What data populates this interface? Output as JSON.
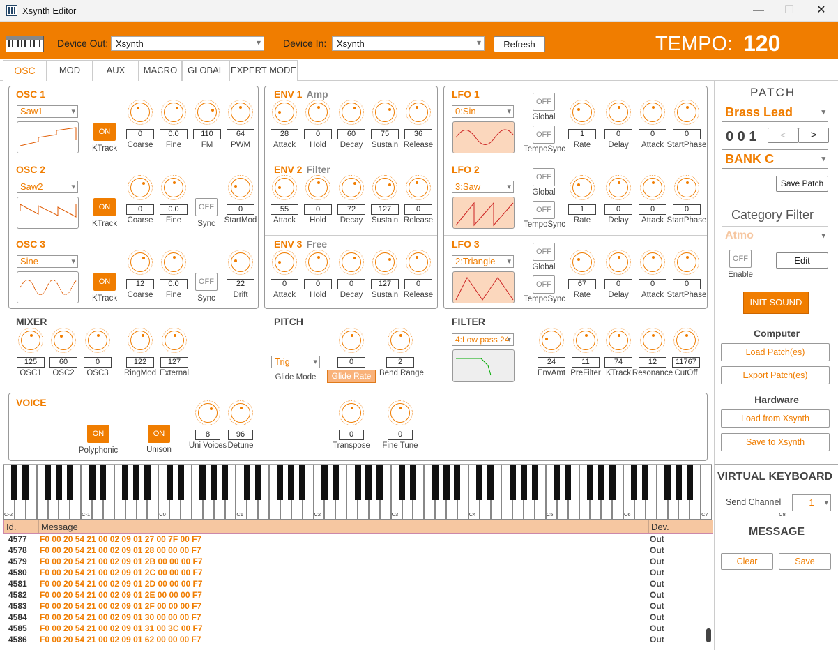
{
  "window": {
    "title": "Xsynth Editor",
    "minimize": "—",
    "maximize": "☐",
    "close": "✕"
  },
  "header": {
    "device_out_label": "Device Out:",
    "device_out_value": "Xsynth",
    "device_in_label": "Device In:",
    "device_in_value": "Xsynth",
    "refresh": "Refresh",
    "tempo_label": "TEMPO:",
    "tempo_value": "120"
  },
  "tabs": [
    "OSC",
    "MOD",
    "AUX",
    "MACRO",
    "GLOBAL",
    "EXPERT MODE"
  ],
  "osc": [
    {
      "title": "OSC 1",
      "wave": "Saw1",
      "ktrack": "ON",
      "ktrack_label": "KTrack",
      "params": [
        {
          "v": "0",
          "l": "Coarse"
        },
        {
          "v": "0.0",
          "l": "Fine"
        },
        {
          "v": "110",
          "l": "FM"
        },
        {
          "v": "64",
          "l": "PWM"
        }
      ]
    },
    {
      "title": "OSC 2",
      "wave": "Saw2",
      "ktrack": "ON",
      "ktrack_label": "KTrack",
      "sync": "OFF",
      "sync_label": "Sync",
      "params": [
        {
          "v": "0",
          "l": "Coarse"
        },
        {
          "v": "0.0",
          "l": "Fine"
        },
        {
          "v": "0",
          "l": "StartMod"
        }
      ]
    },
    {
      "title": "OSC 3",
      "wave": "Sine",
      "ktrack": "ON",
      "ktrack_label": "KTrack",
      "sync": "OFF",
      "sync_label": "Sync",
      "params": [
        {
          "v": "12",
          "l": "Coarse"
        },
        {
          "v": "0.0",
          "l": "Fine"
        },
        {
          "v": "22",
          "l": "Drift"
        }
      ]
    }
  ],
  "env": [
    {
      "title": "ENV 1",
      "sub": "Amp",
      "params": [
        {
          "v": "28",
          "l": "Attack"
        },
        {
          "v": "0",
          "l": "Hold"
        },
        {
          "v": "60",
          "l": "Decay"
        },
        {
          "v": "75",
          "l": "Sustain"
        },
        {
          "v": "36",
          "l": "Release"
        }
      ]
    },
    {
      "title": "ENV 2",
      "sub": "Filter",
      "params": [
        {
          "v": "55",
          "l": "Attack"
        },
        {
          "v": "0",
          "l": "Hold"
        },
        {
          "v": "72",
          "l": "Decay"
        },
        {
          "v": "127",
          "l": "Sustain"
        },
        {
          "v": "0",
          "l": "Release"
        }
      ]
    },
    {
      "title": "ENV 3",
      "sub": "Free",
      "params": [
        {
          "v": "0",
          "l": "Attack"
        },
        {
          "v": "0",
          "l": "Hold"
        },
        {
          "v": "0",
          "l": "Decay"
        },
        {
          "v": "127",
          "l": "Sustain"
        },
        {
          "v": "0",
          "l": "Release"
        }
      ]
    }
  ],
  "lfo": [
    {
      "title": "LFO 1",
      "wave": "0:Sin",
      "global": "OFF",
      "global_label": "Global",
      "temposync": "OFF",
      "temposync_label": "TempoSync",
      "params": [
        {
          "v": "1",
          "l": "Rate"
        },
        {
          "v": "0",
          "l": "Delay"
        },
        {
          "v": "0",
          "l": "Attack"
        },
        {
          "v": "0",
          "l": "StartPhase"
        }
      ]
    },
    {
      "title": "LFO 2",
      "wave": "3:Saw",
      "global": "OFF",
      "global_label": "Global",
      "temposync": "OFF",
      "temposync_label": "TempoSync",
      "params": [
        {
          "v": "1",
          "l": "Rate"
        },
        {
          "v": "0",
          "l": "Delay"
        },
        {
          "v": "0",
          "l": "Attack"
        },
        {
          "v": "0",
          "l": "StartPhase"
        }
      ]
    },
    {
      "title": "LFO 3",
      "wave": "2:Triangle",
      "global": "OFF",
      "global_label": "Global",
      "temposync": "OFF",
      "temposync_label": "TempoSync",
      "params": [
        {
          "v": "67",
          "l": "Rate"
        },
        {
          "v": "0",
          "l": "Delay"
        },
        {
          "v": "0",
          "l": "Attack"
        },
        {
          "v": "0",
          "l": "StartPhase"
        }
      ]
    }
  ],
  "mixer": {
    "title": "MIXER",
    "params": [
      {
        "v": "125",
        "l": "OSC1"
      },
      {
        "v": "60",
        "l": "OSC2"
      },
      {
        "v": "0",
        "l": "OSC3"
      },
      {
        "v": "122",
        "l": "RingMod"
      },
      {
        "v": "127",
        "l": "External"
      }
    ]
  },
  "pitch": {
    "title": "PITCH",
    "glide_mode": "Trig",
    "glide_mode_label": "Glide Mode",
    "glide_rate": "0",
    "glide_rate_label": "Glide Rate",
    "bend_range": "2",
    "bend_range_label": "Bend Range"
  },
  "filter": {
    "title": "FILTER",
    "type": "4:Low pass 24",
    "params": [
      {
        "v": "24",
        "l": "EnvAmt"
      },
      {
        "v": "11",
        "l": "PreFilter"
      },
      {
        "v": "74",
        "l": "KTrack"
      },
      {
        "v": "12",
        "l": "Resonance"
      },
      {
        "v": "11767",
        "l": "CutOff"
      }
    ]
  },
  "voice": {
    "title": "VOICE",
    "polyphonic": "ON",
    "polyphonic_label": "Polyphonic",
    "unison": "ON",
    "unison_label": "Unison",
    "params": [
      {
        "v": "8",
        "l": "Uni Voices"
      },
      {
        "v": "96",
        "l": "Detune"
      },
      {
        "v": "0",
        "l": "Transpose"
      },
      {
        "v": "0",
        "l": "Fine Tune"
      }
    ]
  },
  "patch": {
    "title": "PATCH",
    "name": "Brass Lead",
    "number": "0 0 1",
    "prev": "<",
    "next": ">",
    "bank": "BANK C",
    "save": "Save Patch"
  },
  "category": {
    "title": "Category Filter",
    "value": "Atmo",
    "enable": "OFF",
    "enable_label": "Enable",
    "edit": "Edit",
    "init": "INIT  SOUND"
  },
  "computer": {
    "title": "Computer",
    "load": "Load Patch(es)",
    "export": "Export Patch(es)"
  },
  "hardware": {
    "title": "Hardware",
    "load": "Load from Xsynth",
    "save": "Save to Xsynth"
  },
  "keyboard": {
    "title": "VIRTUAL KEYBOARD",
    "channel_label": "Send Channel",
    "channel": "1",
    "octave_labels": [
      "C-2",
      "C-1",
      "C0",
      "C1",
      "C2",
      "C3",
      "C4",
      "C5",
      "C6",
      "C7",
      "C8"
    ]
  },
  "message": {
    "title": "MESSAGE",
    "clear": "Clear",
    "save": "Save",
    "col_id": "Id.",
    "col_msg": "Message",
    "col_dev": "Dev.",
    "rows": [
      {
        "id": "4577",
        "m": "F0 00 20 54 21 00 02 09 01 27 00 7F 00 F7",
        "d": "Out"
      },
      {
        "id": "4578",
        "m": "F0 00 20 54 21 00 02 09 01 28 00 00 00 F7",
        "d": "Out"
      },
      {
        "id": "4579",
        "m": "F0 00 20 54 21 00 02 09 01 2B 00 00 00 F7",
        "d": "Out"
      },
      {
        "id": "4580",
        "m": "F0 00 20 54 21 00 02 09 01 2C 00 00 00 F7",
        "d": "Out"
      },
      {
        "id": "4581",
        "m": "F0 00 20 54 21 00 02 09 01 2D 00 00 00 F7",
        "d": "Out"
      },
      {
        "id": "4582",
        "m": "F0 00 20 54 21 00 02 09 01 2E 00 00 00 F7",
        "d": "Out"
      },
      {
        "id": "4583",
        "m": "F0 00 20 54 21 00 02 09 01 2F 00 00 00 F7",
        "d": "Out"
      },
      {
        "id": "4584",
        "m": "F0 00 20 54 21 00 02 09 01 30 00 00 00 F7",
        "d": "Out"
      },
      {
        "id": "4585",
        "m": "F0 00 20 54 21 00 02 09 01 31 00 3C 00 F7",
        "d": "Out"
      },
      {
        "id": "4586",
        "m": "F0 00 20 54 21 00 02 09 01 62 00 00 00 F7",
        "d": "Out"
      }
    ]
  },
  "colors": {
    "accent": "#f07d00",
    "lfo_bg": "#fbd7bd",
    "table_head": "#f6c7a1"
  }
}
